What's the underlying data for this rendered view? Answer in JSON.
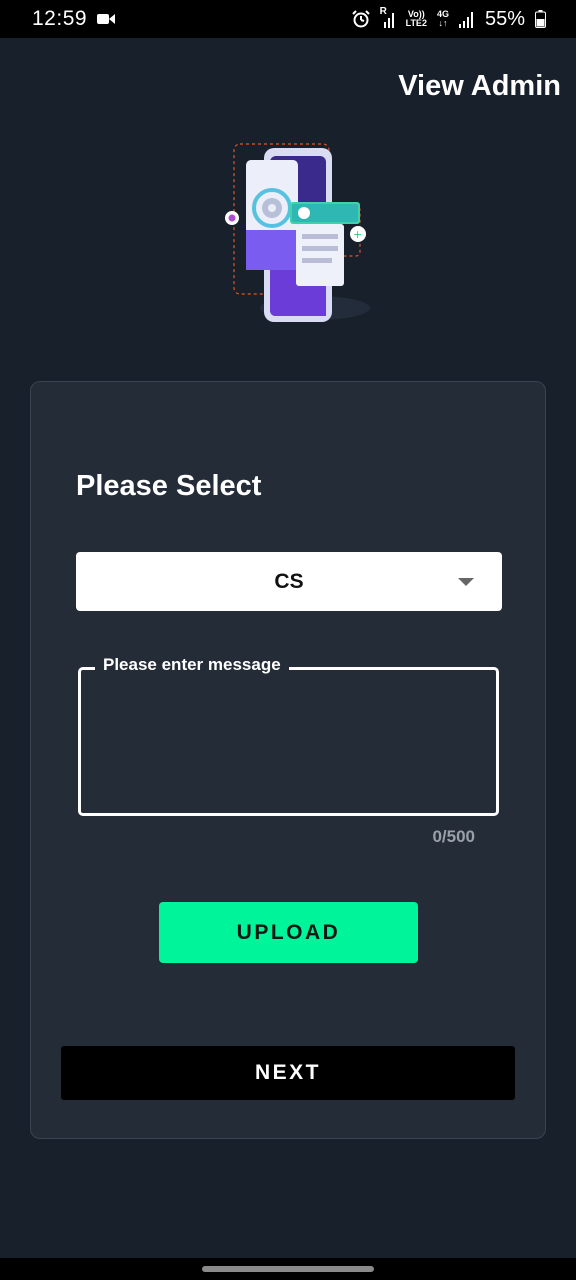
{
  "status_bar": {
    "time": "12:59",
    "signal_label_1": "R",
    "network_top": "Vo))",
    "network_bottom": "LTE2",
    "network_gen": "4G",
    "battery_percent": "55%",
    "icons": [
      "video-camera-icon",
      "alarm-icon",
      "signal-icon",
      "signal-icon",
      "battery-icon"
    ]
  },
  "header": {
    "view_admin_label": "View Admin"
  },
  "form": {
    "heading": "Please Select",
    "dropdown": {
      "selected": "CS"
    },
    "message": {
      "label": "Please enter message",
      "value": "",
      "counter": "0/500"
    },
    "upload_label": "UPLOAD",
    "next_label": "NEXT"
  },
  "colors": {
    "background": "#18202b",
    "card": "#242c38",
    "accent_green": "#00f59b",
    "next_button": "#000000"
  }
}
